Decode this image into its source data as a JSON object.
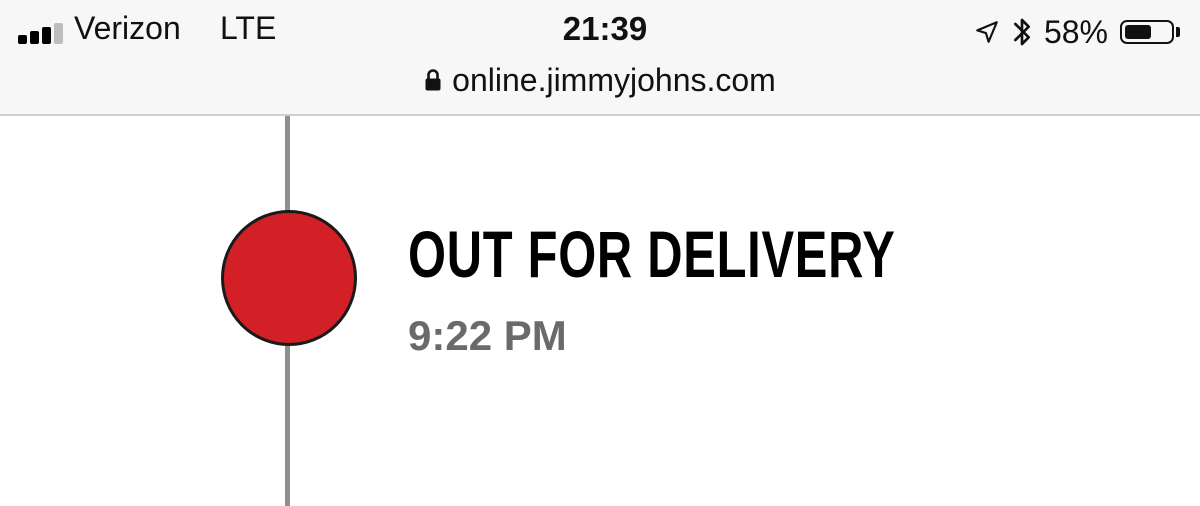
{
  "status_bar": {
    "carrier": "Verizon",
    "network": "LTE",
    "time": "21:39",
    "battery_percent": "58%",
    "signal_bars_filled": 3,
    "signal_bars_total": 4,
    "battery_level": 0.58,
    "icons": [
      "signal-icon",
      "location-arrow-icon",
      "bluetooth-icon",
      "battery-icon"
    ]
  },
  "browser": {
    "url": "online.jimmyjohns.com",
    "secure_icon": "lock-icon"
  },
  "tracker": {
    "step_title": "OUT FOR DELIVERY",
    "step_time": "9:22 PM",
    "dot_color": "#d32027",
    "line_color": "#8f8f8f"
  }
}
